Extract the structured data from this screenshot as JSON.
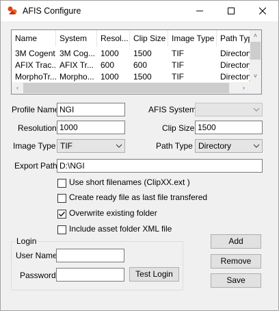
{
  "window": {
    "title": "AFIS Configure"
  },
  "list": {
    "columns": [
      "Name",
      "System",
      "Resol...",
      "Clip Size",
      "Image Type",
      "Path Typ"
    ],
    "rows": [
      [
        "3M Cogent",
        "3M Cog...",
        "1000",
        "1500",
        "TIF",
        "Directory"
      ],
      [
        "AFIX Trac...",
        "AFIX Tr...",
        "600",
        "600",
        "TIF",
        "Directory"
      ],
      [
        "MorphoTr...",
        "Morpho...",
        "1000",
        "1500",
        "TIF",
        "Directory"
      ]
    ]
  },
  "form": {
    "profile_name_label": "Profile Name",
    "profile_name_value": "NGI",
    "afis_system_label": "AFIS System",
    "afis_system_value": "",
    "resolution_label": "Resolution",
    "resolution_value": "1000",
    "clip_size_label": "Clip Size",
    "clip_size_value": "1500",
    "image_type_label": "Image Type",
    "image_type_value": "TIF",
    "path_type_label": "Path Type",
    "path_type_value": "Directory",
    "export_path_label": "Export Path",
    "export_path_value": "D:\\NGI"
  },
  "options": {
    "short_filenames": {
      "label": "Use short filenames (ClipXX.ext )",
      "checked": false
    },
    "ready_file": {
      "label": "Create ready file as last file transfered",
      "checked": false
    },
    "overwrite": {
      "label": "Overwrite existing folder",
      "checked": true
    },
    "asset_xml": {
      "label": "Include asset folder XML file",
      "checked": false
    }
  },
  "login": {
    "group_title": "Login",
    "user_name_label": "User Name",
    "user_name_value": "",
    "password_label": "Password",
    "password_value": "",
    "test_login_label": "Test Login"
  },
  "buttons": {
    "add": "Add",
    "remove": "Remove",
    "save": "Save"
  },
  "icons": {
    "app": "afis-app-icon",
    "minimize": "minimize-icon",
    "maximize": "maximize-icon",
    "close": "close-icon",
    "check": "checkmark-icon",
    "chevron": "chevron-down-icon"
  }
}
